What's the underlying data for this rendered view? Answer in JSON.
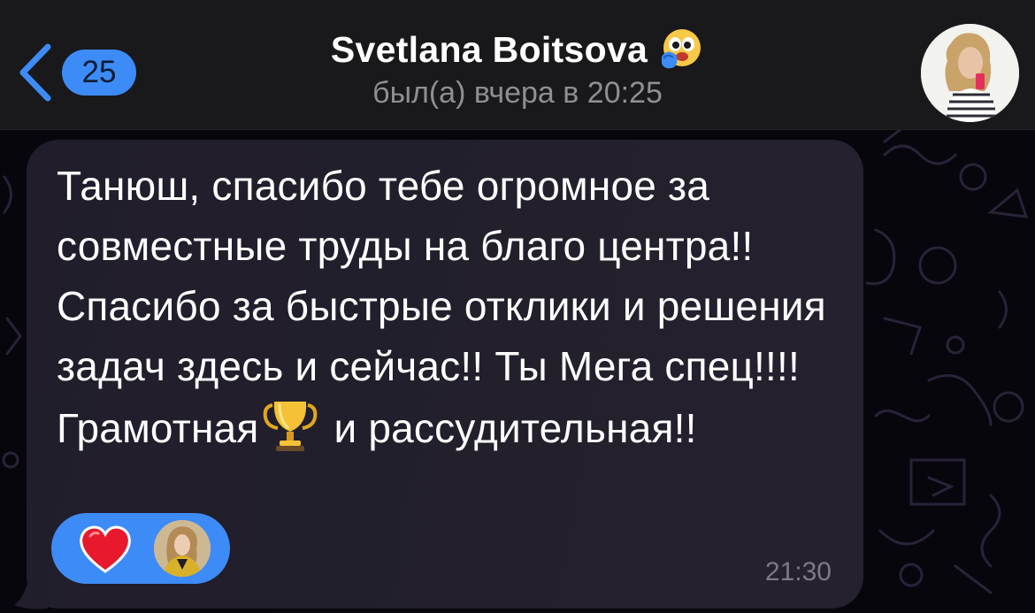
{
  "header": {
    "back_badge_count": "25",
    "title": "Svetlana Boitsova",
    "title_emoji_icon": "face-with-hand-over-mouth-emoji",
    "last_seen": "был(а) вчера в 20:25"
  },
  "message": {
    "text_before_emoji": "Танюш, спасибо тебе огромное за совместные труды на благо центра!! Спасибо за быстрые отклики и решения задач здесь и сейчас!! Ты Мега спец!!!! Грамотная",
    "inline_emoji_icon": "trophy-icon",
    "text_after_emoji": " и рассудительная!!",
    "time": "21:30",
    "reaction_icon": "heart-icon"
  },
  "colors": {
    "accent": "#3d8bf7",
    "header_bg": "#19191b",
    "bubble_bg": "#23202c",
    "background": "#07060d"
  }
}
